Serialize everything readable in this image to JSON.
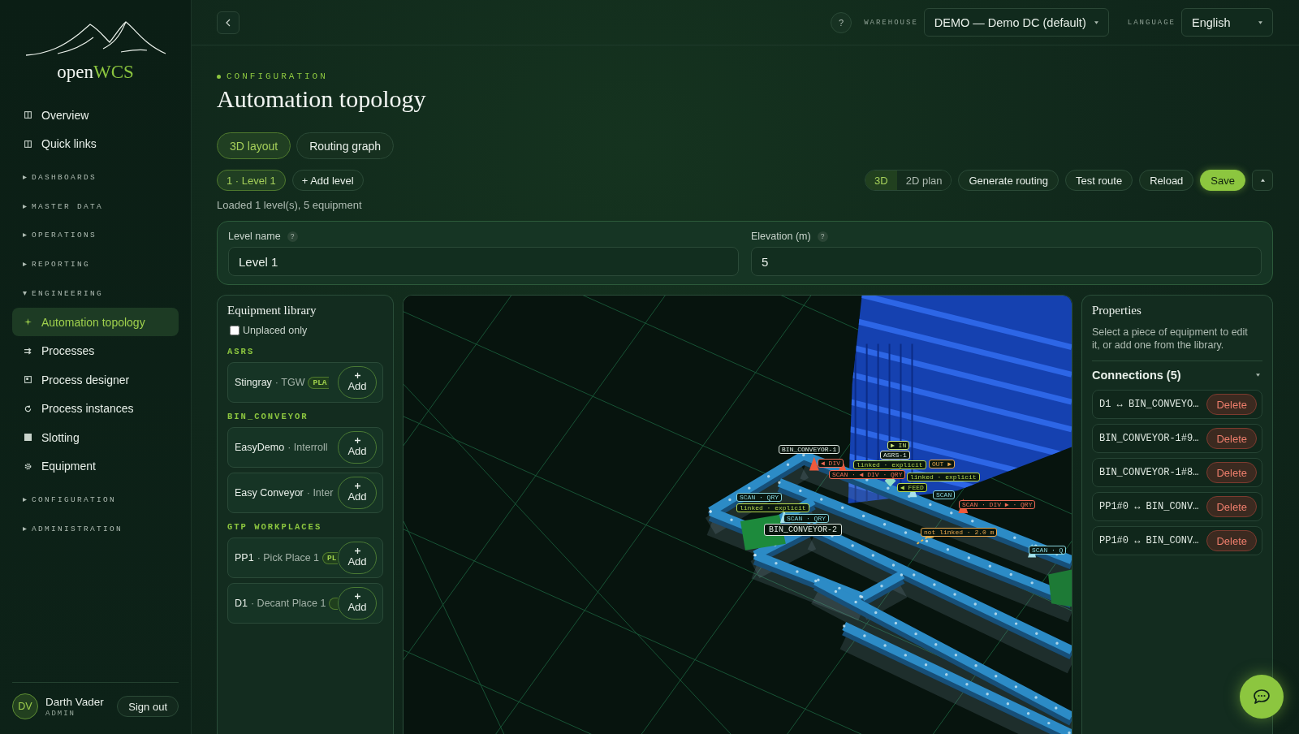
{
  "sidebar": {
    "logo": {
      "first": "open",
      "second": "WCS"
    },
    "links": [
      {
        "label": "Overview",
        "selected": false
      },
      {
        "label": "Quick links",
        "selected": false
      }
    ],
    "sections": [
      {
        "label": "DASHBOARDS",
        "expanded": false
      },
      {
        "label": "MASTER DATA",
        "expanded": false
      },
      {
        "label": "OPERATIONS",
        "expanded": false
      },
      {
        "label": "REPORTING",
        "expanded": false
      },
      {
        "label": "ENGINEERING",
        "expanded": true,
        "items": [
          {
            "label": "Automation topology",
            "selected": true
          },
          {
            "label": "Processes",
            "selected": false
          },
          {
            "label": "Process designer",
            "selected": false
          },
          {
            "label": "Process instances",
            "selected": false
          },
          {
            "label": "Slotting",
            "selected": false
          },
          {
            "label": "Equipment",
            "selected": false
          }
        ]
      },
      {
        "label": "CONFIGURATION",
        "expanded": false
      },
      {
        "label": "ADMINISTRATION",
        "expanded": false
      }
    ],
    "user": {
      "initials": "DV",
      "name": "Darth Vader",
      "role": "ADMIN",
      "sign_out": "Sign out"
    }
  },
  "topbar": {
    "help": "?",
    "warehouse": {
      "label": "WAREHOUSE",
      "value": "DEMO — Demo DC (default)"
    },
    "language": {
      "label": "LANGUAGE",
      "value": "English"
    }
  },
  "page": {
    "eyebrow": "CONFIGURATION",
    "title": "Automation topology"
  },
  "tabs": [
    {
      "label": "3D layout",
      "selected": true
    },
    {
      "label": "Routing graph",
      "selected": false
    }
  ],
  "levels": [
    {
      "label": "1 · Level 1",
      "selected": true
    }
  ],
  "add_level": "+ Add level",
  "view_modes": [
    {
      "label": "3D",
      "selected": true
    },
    {
      "label": "2D plan",
      "selected": false
    }
  ],
  "actions": [
    {
      "label": "Generate routing",
      "kind": "plain"
    },
    {
      "label": "Test route",
      "kind": "plain"
    },
    {
      "label": "Reload",
      "kind": "plain"
    },
    {
      "label": "Save",
      "kind": "primary"
    }
  ],
  "status": "Loaded 1 level(s), 5 equipment",
  "level_form": {
    "fields": [
      {
        "label": "Level name",
        "help": "?",
        "value": "Level 1"
      },
      {
        "label": "Elevation (m)",
        "help": "?",
        "value": "5"
      }
    ]
  },
  "library": {
    "title": "Equipment library",
    "unplaced_only": {
      "label": "Unplaced only",
      "checked": false
    },
    "groups": [
      {
        "name": "ASRS",
        "items": [
          {
            "name": "Stingray",
            "vendor": "· TGW",
            "placed": true,
            "badge": "PLA",
            "button": "Add"
          }
        ]
      },
      {
        "name": "BIN_CONVEYOR",
        "items": [
          {
            "name": "EasyDemo",
            "vendor": "· Interroll",
            "placed": false,
            "button": "Add"
          },
          {
            "name": "Easy Conveyor",
            "vendor": "· Inter",
            "placed": false,
            "button": "Add"
          }
        ]
      },
      {
        "name": "GTP WORKPLACES",
        "items": [
          {
            "name": "PP1",
            "vendor": "· Pick Place 1",
            "placed": true,
            "badge": "PL",
            "button": "Add"
          },
          {
            "name": "D1",
            "vendor": "· Decant Place 1",
            "placed": true,
            "button": "Add"
          }
        ]
      }
    ]
  },
  "viewport": {
    "labels": [
      {
        "text": "BIN_CONVEYOR-1",
        "color": "#dfe9e2",
        "highlighted": false
      },
      {
        "text": "▶ IN",
        "color": "#c9e37a",
        "highlighted": false
      },
      {
        "text": "ASRS-1",
        "color": "#dfe9e2",
        "highlighted": false
      },
      {
        "text": "◀ DIV",
        "color": "#ee6a55",
        "highlighted": false
      },
      {
        "text": "linked · explicit",
        "color": "#b7d94f",
        "highlighted": false
      },
      {
        "text": "OUT ▶",
        "color": "#e8a64c",
        "highlighted": false
      },
      {
        "text": "SCAN · ◀ DIV · QRY",
        "color": "#ee6a55",
        "highlighted": false
      },
      {
        "text": "linked · explicit",
        "color": "#b7d94f",
        "highlighted": false
      },
      {
        "text": "◀ FEED",
        "color": "#b7d94f",
        "highlighted": false
      },
      {
        "text": "SCAN",
        "color": "#86d3dc",
        "highlighted": false
      },
      {
        "text": "SCAN · QRY",
        "color": "#86d3dc",
        "highlighted": false
      },
      {
        "text": "linked · explicit",
        "color": "#b7d94f",
        "highlighted": false
      },
      {
        "text": "SCAN · QRY",
        "color": "#86d3dc",
        "highlighted": false
      },
      {
        "text": "BIN_CONVEYOR-2",
        "color": "#dfe9e2",
        "highlighted": true
      },
      {
        "text": "SCAN · DIV ▶ · QRY",
        "color": "#ee6a55",
        "highlighted": false
      },
      {
        "text": "not linked · 2.0 m",
        "color": "#e8a64c",
        "highlighted": false
      },
      {
        "text": "SCAN · Q",
        "color": "#86d3dc",
        "highlighted": false
      }
    ]
  },
  "properties": {
    "title": "Properties",
    "hint": "Select a piece of equipment to edit it, or add one from the library.",
    "connections": {
      "title": "Connections (5)",
      "expanded": true,
      "items": [
        {
          "text": "D1 ↔ BIN_CONVEYO…",
          "button": "Delete"
        },
        {
          "text": "BIN_CONVEYOR-1#9…",
          "button": "Delete"
        },
        {
          "text": "BIN_CONVEYOR-1#8…",
          "button": "Delete"
        },
        {
          "text": "PP1#0 ↔ BIN_CONV…",
          "button": "Delete"
        },
        {
          "text": "PP1#0 ↔ BIN_CONV…",
          "button": "Delete"
        }
      ]
    }
  }
}
